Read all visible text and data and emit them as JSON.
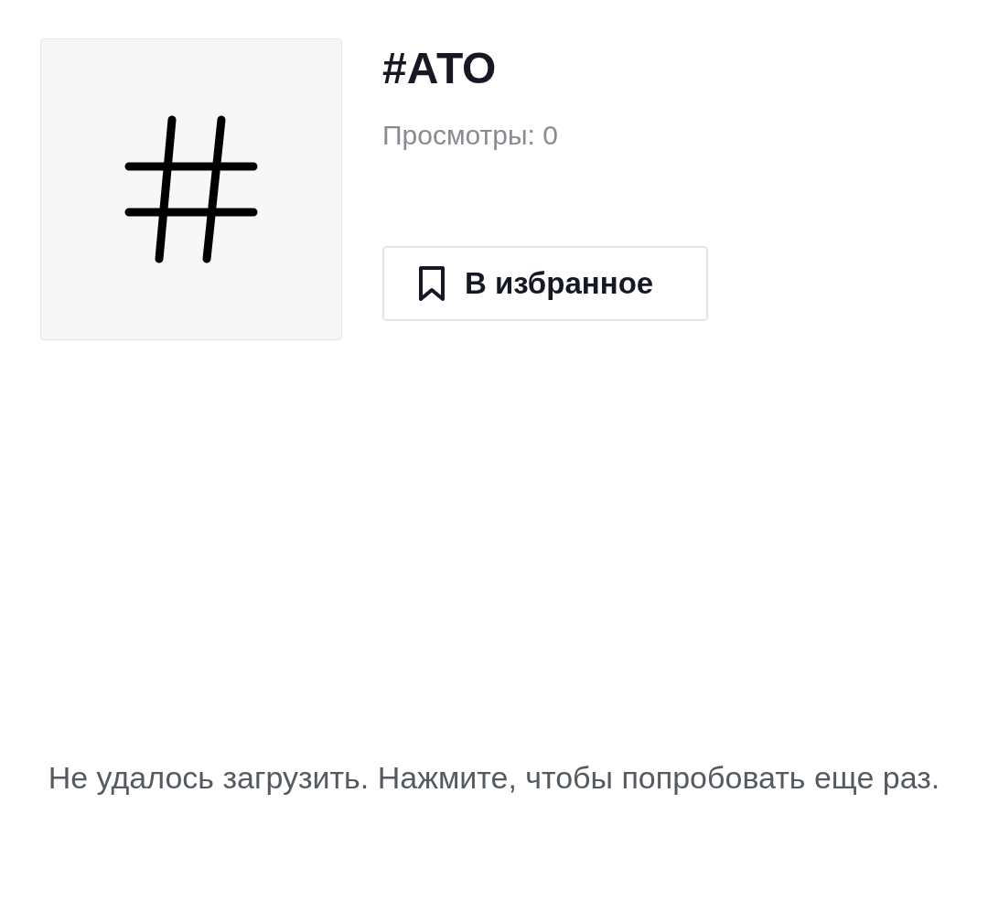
{
  "tag": {
    "title": "#АТО",
    "views": "Просмотры: 0"
  },
  "favorite_button": {
    "label": "В избранное"
  },
  "error": {
    "message": "Не удалось загрузить. Нажмите, чтобы попробовать еще раз."
  }
}
